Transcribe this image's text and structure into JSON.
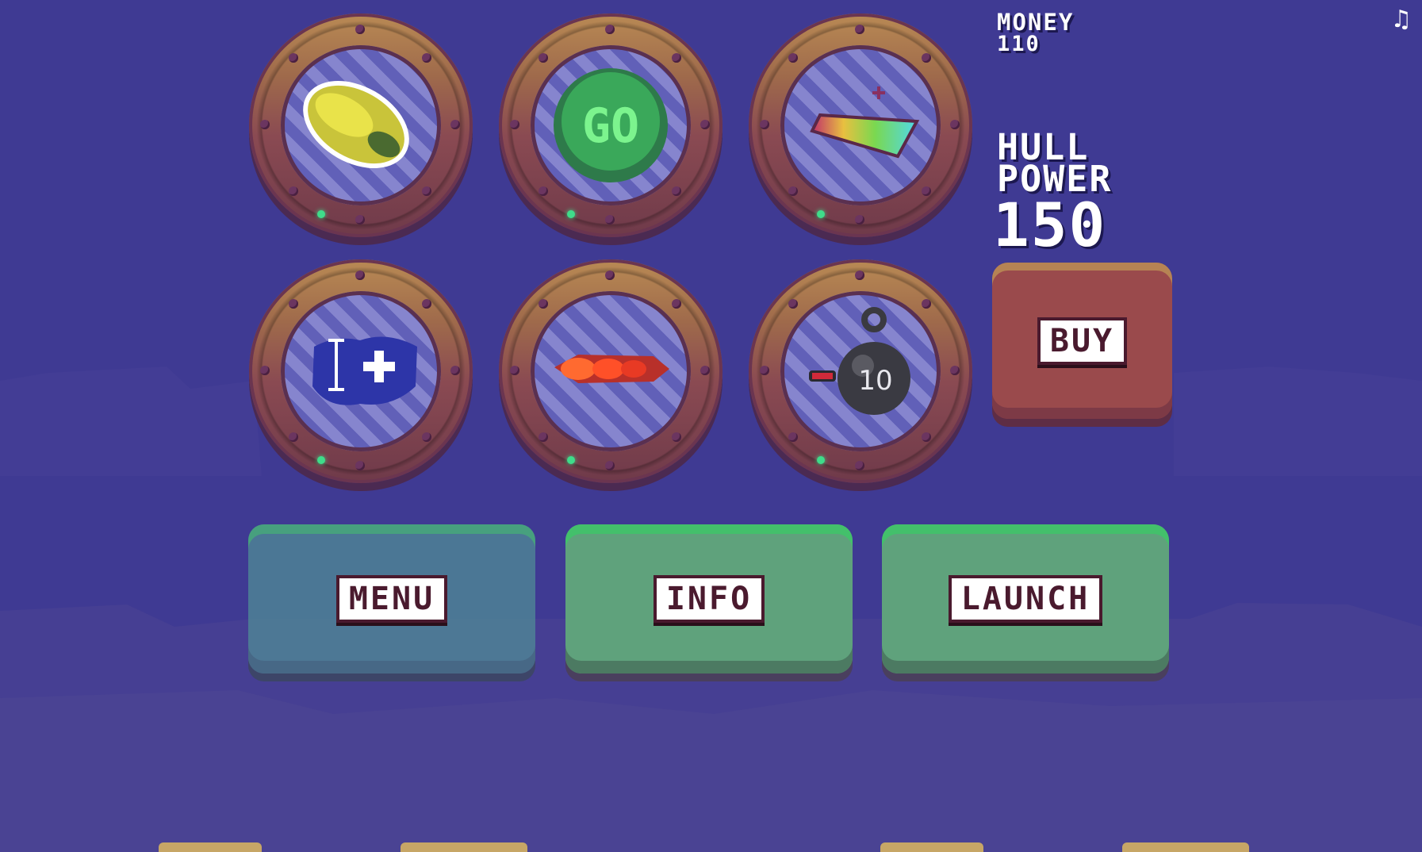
{
  "hud": {
    "money_label": "MONEY",
    "money_value": "110",
    "hull_label": "HULL",
    "power_label": "POWER",
    "power_value": "150"
  },
  "upgrades": [
    {
      "name": "yellow-seed",
      "label": ""
    },
    {
      "name": "go-boost",
      "label": "GO"
    },
    {
      "name": "rainbow-wing",
      "label": ""
    },
    {
      "name": "shield-plus",
      "label": ""
    },
    {
      "name": "red-rocket",
      "label": ""
    },
    {
      "name": "bomb",
      "label": "10"
    }
  ],
  "buttons": {
    "buy": "BUY",
    "menu": "MENU",
    "info": "INFO",
    "launch": "LAUNCH"
  },
  "colors": {
    "background": "#3f3a93",
    "buy_button": "#9a4a4c",
    "green_button": "#5fa27c",
    "text_outline": "#4a1a2e"
  },
  "icons": {
    "music": "music-note-icon"
  }
}
